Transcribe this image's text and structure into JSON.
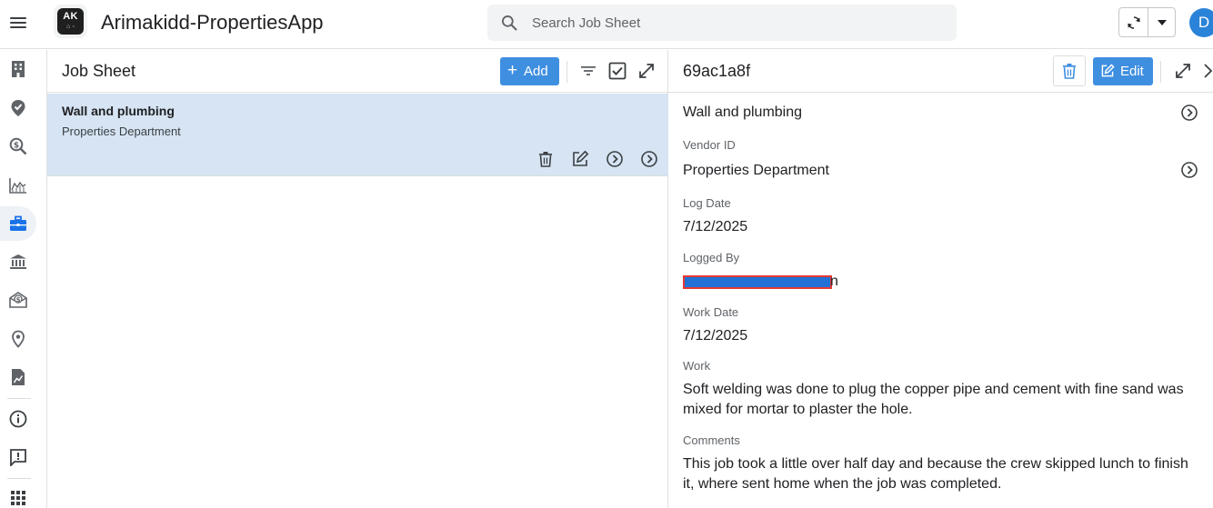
{
  "app": {
    "title": "Arimakidd-PropertiesApp",
    "logo_text": "AK",
    "logo_sub": "⌂ ◦",
    "avatar_initial": "D"
  },
  "search": {
    "placeholder": "Search Job Sheet",
    "value": ""
  },
  "toolbar": {
    "sync_icon": "sync-icon",
    "dropdown_icon": "caret-down-icon"
  },
  "rail": {
    "items": [
      {
        "icon": "building-icon"
      },
      {
        "icon": "map-pin-check-icon"
      },
      {
        "icon": "search-dollar-icon"
      },
      {
        "icon": "area-chart-icon"
      },
      {
        "icon": "briefcase-icon",
        "active": true
      },
      {
        "icon": "bank-icon"
      },
      {
        "icon": "money-envelope-icon"
      },
      {
        "icon": "location-pin-icon"
      },
      {
        "icon": "report-icon"
      },
      {
        "icon": "info-icon"
      },
      {
        "icon": "feedback-icon"
      },
      {
        "icon": "apps-grid-icon"
      }
    ]
  },
  "list": {
    "title": "Job Sheet",
    "add_label": "Add",
    "add_symbol": "+",
    "rows": [
      {
        "title": "Wall and plumbing",
        "subtitle": "Properties Department"
      }
    ]
  },
  "detail": {
    "title": "69ac1a8f",
    "edit_label": "Edit",
    "name": "Wall and plumbing",
    "vendor_label": "Vendor ID",
    "vendor_value": "Properties Department",
    "log_date_label": "Log Date",
    "log_date_value": "7/12/2025",
    "logged_by_label": "Logged By",
    "logged_by_tail": "n",
    "work_date_label": "Work Date",
    "work_date_value": "7/12/2025",
    "work_label": "Work",
    "work_value": "Soft welding was done to plug the copper pipe and cement with fine sand was mixed for mortar to plaster the hole.",
    "comments_label": "Comments",
    "comments_value": "This job took a little over half day and because the crew skipped lunch to finish it, where sent home when the job was completed."
  },
  "colors": {
    "accent": "#3f8fe0",
    "selected_row": "#d6e4f3",
    "avatar": "#2a83d8",
    "redaction_fill": "#2471d6",
    "redaction_border": "#e53935"
  }
}
